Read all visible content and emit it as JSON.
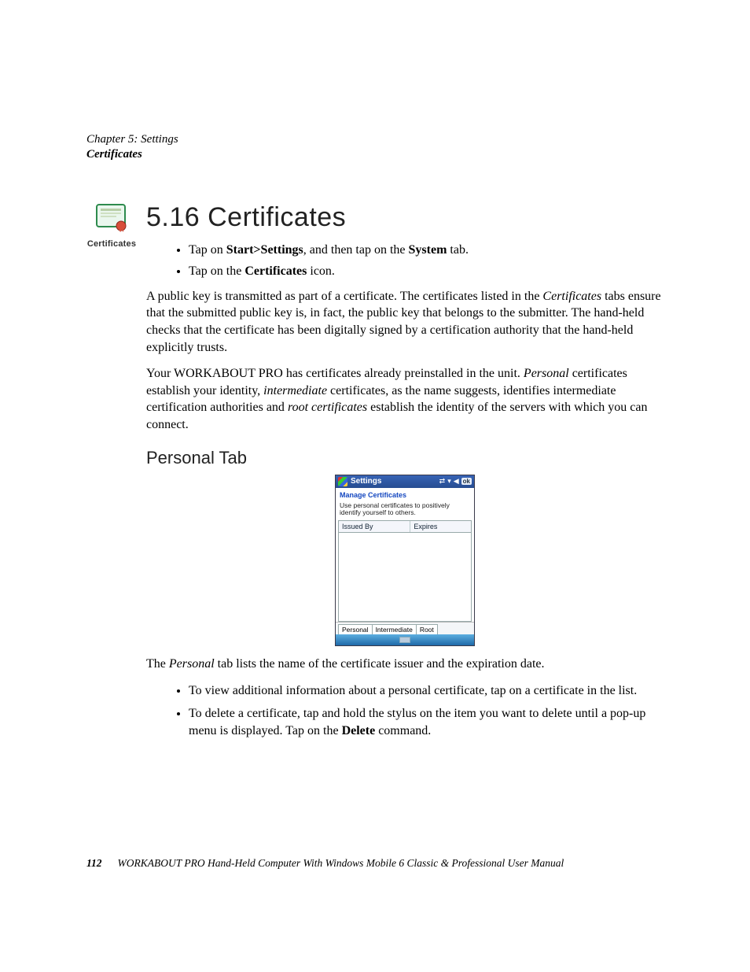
{
  "header": {
    "chapter": "Chapter 5: Settings",
    "section": "Certificates"
  },
  "sidebar_icon": {
    "label": "Certificates"
  },
  "section_heading": "5.16  Certificates",
  "steps": {
    "s1a": "Tap on ",
    "s1b": "Start>Settings",
    "s1c": ", and then tap on the ",
    "s1d": "System",
    "s1e": " tab.",
    "s2a": "Tap on the ",
    "s2b": "Certificates",
    "s2c": " icon."
  },
  "para1": {
    "a": "A public key is transmitted as part of a certificate. The certificates listed in the ",
    "b": "Certificates",
    "c": " tabs ensure that the submitted public key is, in fact, the public key that belongs to the submitter. The hand-held checks that the certificate has been digitally signed by a certification authority that the hand-held explicitly trusts."
  },
  "para2": {
    "a": "Your WORKABOUT PRO has certificates already preinstalled in the unit. ",
    "b": "Personal",
    "c": " certificates establish your identity, ",
    "d": "intermediate",
    "e": " certificates, as the name suggests, identifies intermediate certification authorities and ",
    "f": "root certificates",
    "g": " establish the identity of the servers with which you can connect."
  },
  "subhead": "Personal Tab",
  "device": {
    "title": "Settings",
    "ok": "ok",
    "subtitle": "Manage Certificates",
    "hint": "Use personal certificates to positively identify yourself to others.",
    "col1": "Issued By",
    "col2": "Expires",
    "tabs": [
      "Personal",
      "Intermediate",
      "Root"
    ]
  },
  "para3": {
    "a": "The ",
    "b": "Personal",
    "c": " tab lists the name of the certificate issuer and the expiration date."
  },
  "after": {
    "b1": "To view additional information about a personal certificate, tap on a certificate in the list.",
    "b2a": "To delete a certificate, tap and hold the stylus on the item you want to delete until a pop-up menu is displayed. Tap on the ",
    "b2b": "Delete",
    "b2c": " command."
  },
  "footer": {
    "page": "112",
    "text": "WORKABOUT PRO Hand-Held Computer With Windows Mobile 6 Classic & Professional User Manual"
  }
}
